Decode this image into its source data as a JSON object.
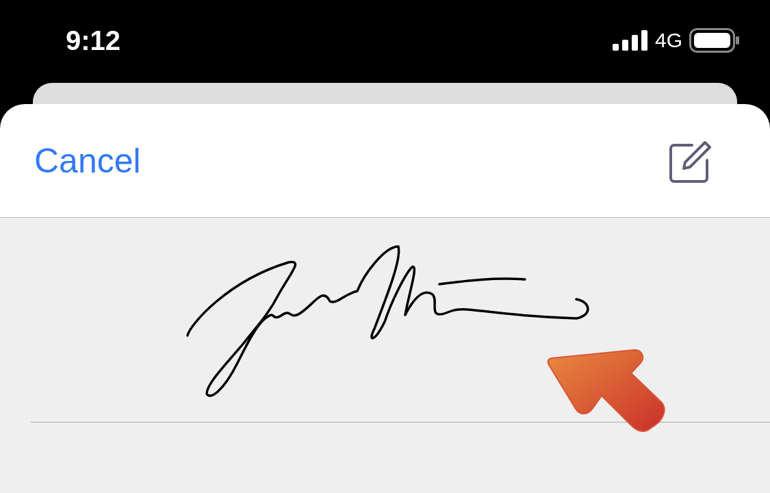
{
  "status_bar": {
    "time": "9:12",
    "network": "4G"
  },
  "header": {
    "cancel_label": "Cancel"
  }
}
